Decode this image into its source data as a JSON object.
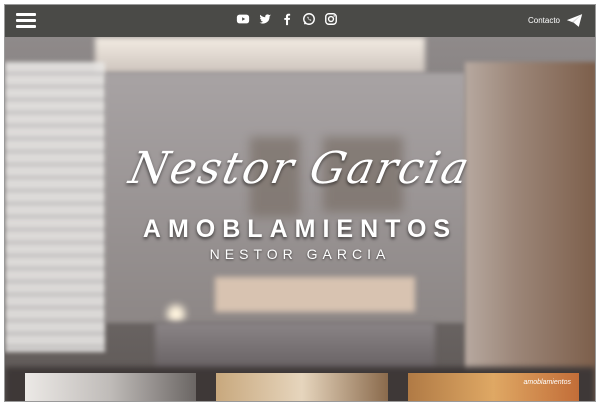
{
  "header": {
    "menu_icon": "hamburger-icon",
    "social": [
      {
        "name": "youtube-icon"
      },
      {
        "name": "twitter-icon"
      },
      {
        "name": "facebook-icon"
      },
      {
        "name": "whatsapp-icon"
      },
      {
        "name": "instagram-icon"
      }
    ],
    "contact_label": "Contacto",
    "contact_icon": "paper-plane-icon"
  },
  "hero": {
    "script_title": "Nestor Garcia",
    "title": "AMOBLAMIENTOS",
    "subtitle": "NESTOR GARCIA"
  },
  "gallery": {
    "thumb3_label": "amoblamientos"
  },
  "colors": {
    "topbar": "#4a4a47",
    "text": "#ffffff"
  }
}
